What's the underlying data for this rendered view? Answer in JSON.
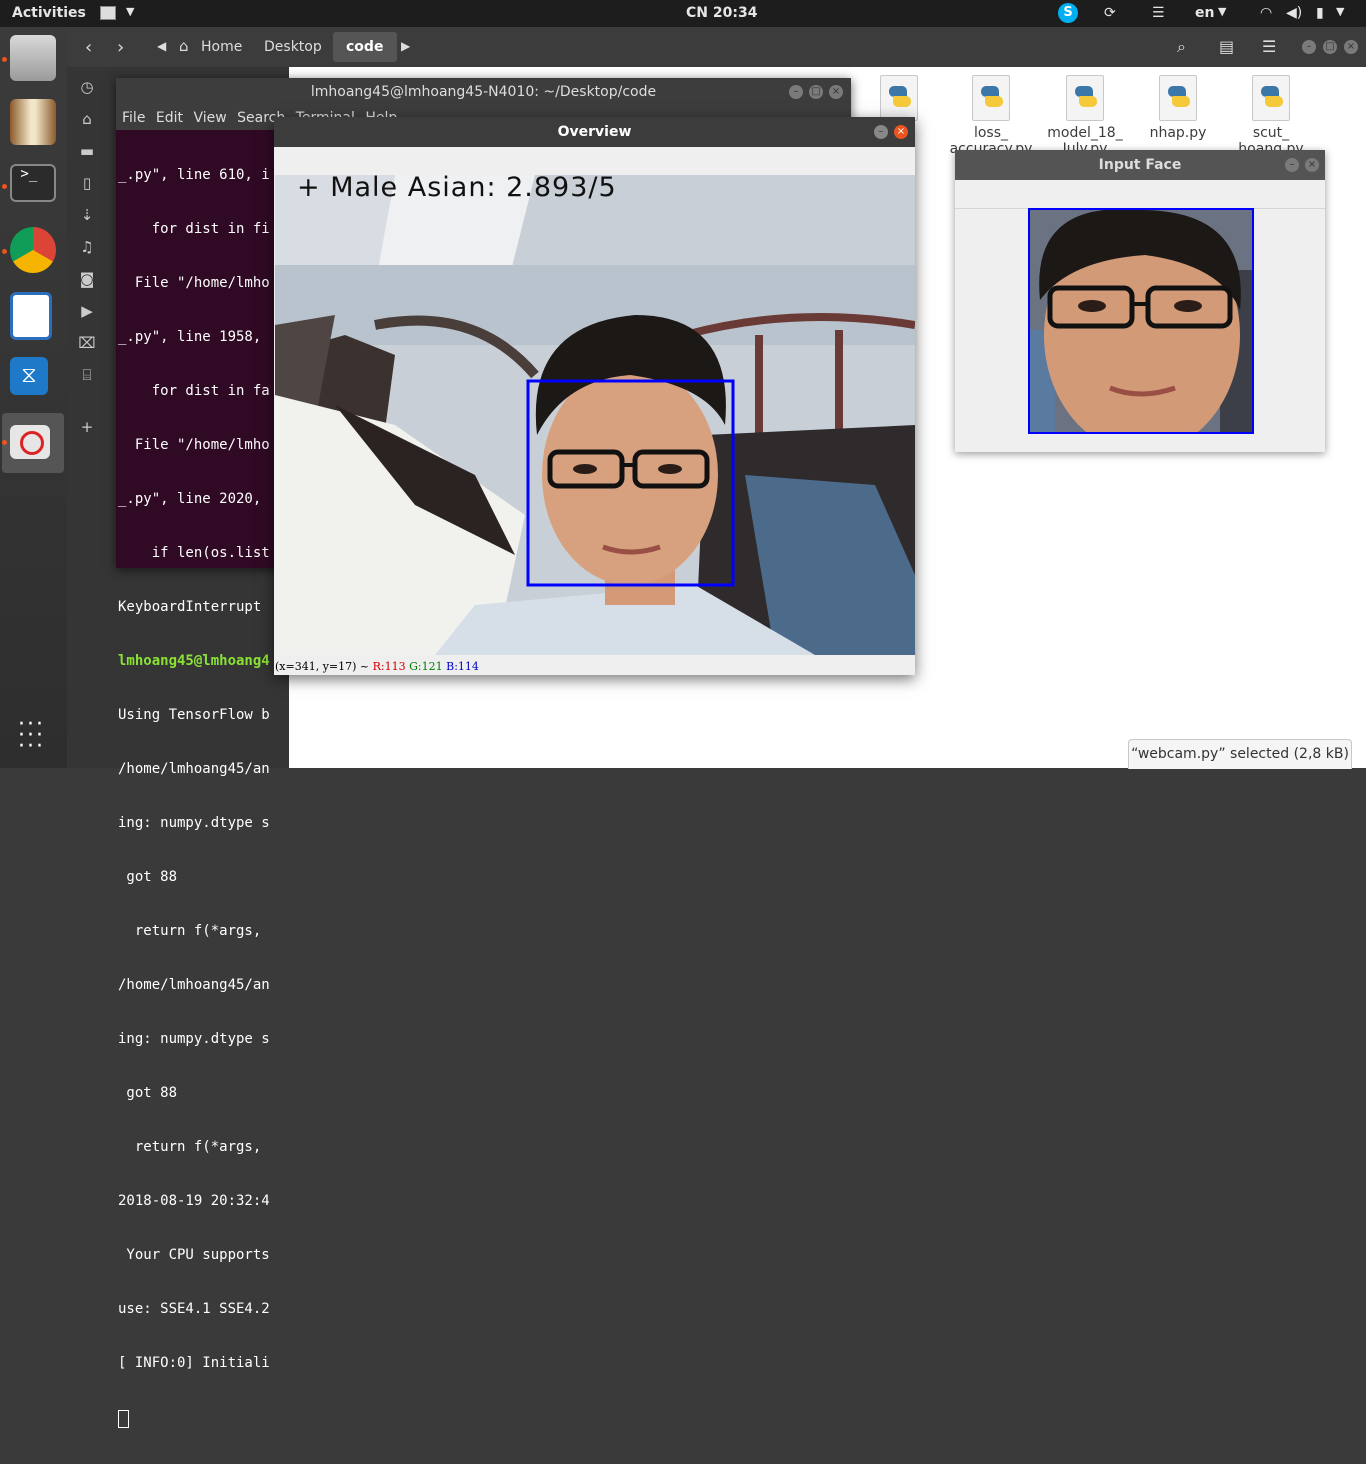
{
  "topbar": {
    "activities": "Activities",
    "clock": "CN 20:34",
    "lang": "en"
  },
  "files": {
    "nav": [
      "Home",
      "Desktop",
      "code"
    ],
    "sidebar_ghosts": [
      "Desktop",
      "Documents",
      "Downloads",
      "Music",
      "Pictures",
      "Videos"
    ],
    "items": [
      {
        "label": "loss_\naccuracy.py"
      },
      {
        "label": "model_18_\nJuly.py"
      },
      {
        "label": "nhap.py"
      },
      {
        "label": "scut_\nhoang.py"
      }
    ],
    "selection_status": "“webcam.py” selected  (2,8 kB)"
  },
  "terminal": {
    "title": "lmhoang45@lmhoang45-N4010: ~/Desktop/code",
    "menu": [
      "File",
      "Edit",
      "View",
      "Search",
      "Terminal",
      "Help"
    ],
    "lines": [
      "_.py\", line 610, i",
      "    for dist in fi",
      "  File \"/home/lmho",
      "_.py\", line 1958,",
      "    for dist in fa",
      "  File \"/home/lmho",
      "_.py\", line 2020,",
      "    if len(os.list",
      "KeyboardInterrupt",
      "lmhoang45@lmhoang4",
      "Using TensorFlow b",
      "/home/lmhoang45/an",
      "ing: numpy.dtype s",
      " got 88",
      "  return f(*args,",
      "/home/lmhoang45/an",
      "ing: numpy.dtype s",
      " got 88",
      "  return f(*args,",
      "2018-08-19 20:32:4",
      " Your CPU supports",
      "use: SSE4.1 SSE4.2",
      "[ INFO:0] Initiali"
    ]
  },
  "overview": {
    "title": "Overview",
    "overlay_text": "+ Male Asian: 2.893/5",
    "status_coords": "(x=341, y=17) ~",
    "status_r": "R:113",
    "status_g": "G:121",
    "status_b": "B:114"
  },
  "input_face": {
    "title": "Input Face"
  },
  "colors": {
    "accent": "#e95420",
    "box": "#0000ff",
    "terminal_bg": "#300a24",
    "prompt": "#8ae234"
  }
}
